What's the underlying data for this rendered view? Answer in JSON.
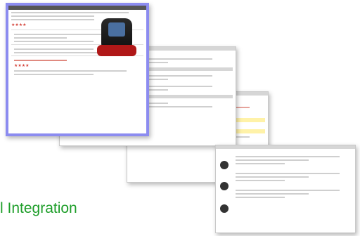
{
  "caption": "l Integration",
  "colors": {
    "caption": "#1e9e2a",
    "frame_border": "#8c8cf0",
    "highlight": "#fff2a8",
    "accent_red": "#c0392b"
  },
  "screens": [
    {
      "id": "product-page"
    },
    {
      "id": "review-page"
    },
    {
      "id": "form-page"
    },
    {
      "id": "list-page"
    }
  ]
}
